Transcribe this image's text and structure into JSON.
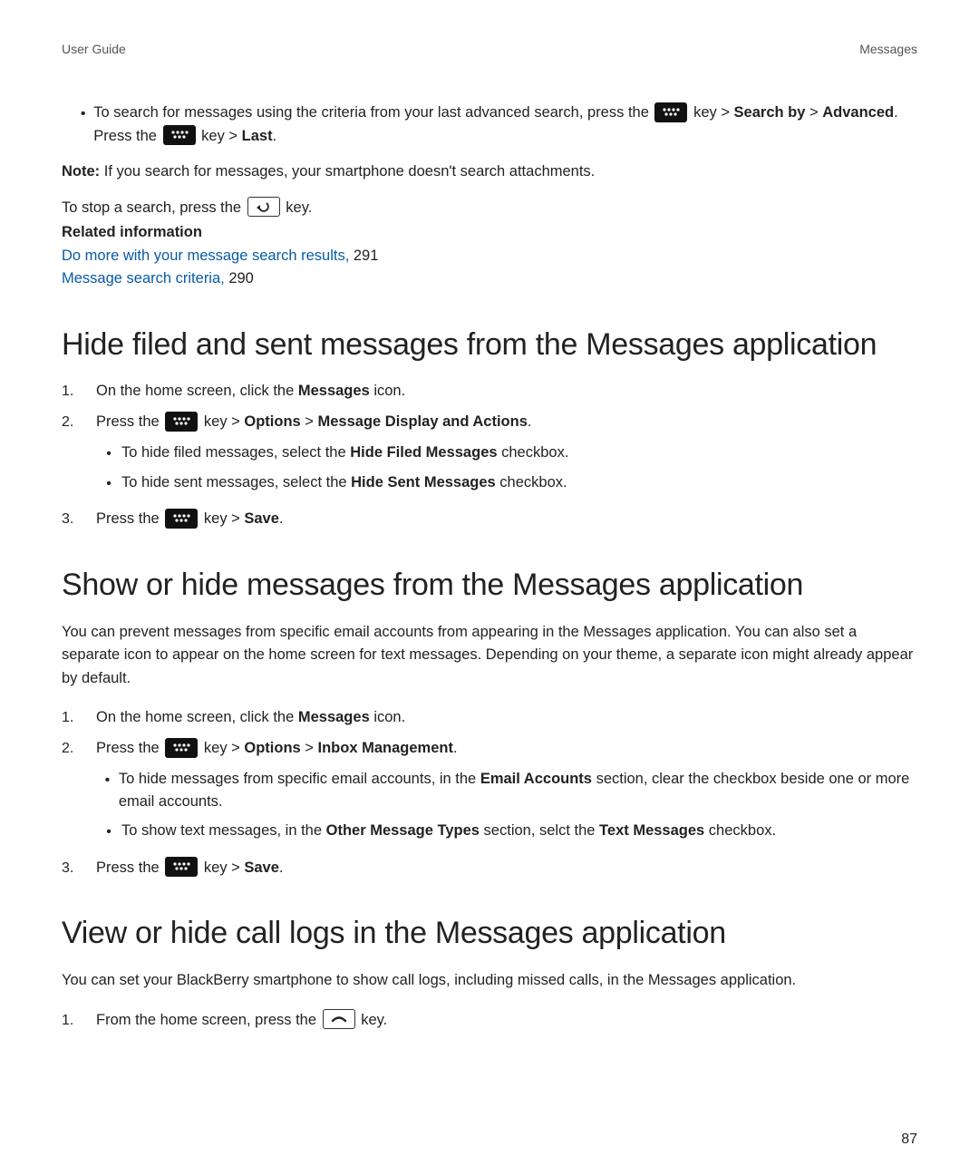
{
  "header": {
    "left": "User Guide",
    "right": "Messages"
  },
  "searchBullet": {
    "pre": "To search for messages using the criteria from your last advanced search, press the ",
    "key1": " key > ",
    "searchBy": "Search by",
    "gt1": " > ",
    "advanced": "Advanced",
    "pressThe": ". Press the ",
    "key2": " key > ",
    "last": "Last",
    "period": "."
  },
  "note": {
    "label": "Note:",
    "text": " If you search for messages, your smartphone doesn't search attachments."
  },
  "stopSearch": {
    "pre": "To stop a search, press the ",
    "post": " key."
  },
  "related": {
    "heading": "Related information",
    "link1": "Do more with your message search results,",
    "num1": " 291",
    "link2": "Message search criteria,",
    "num2": " 290"
  },
  "sectionA": {
    "title": "Hide filed and sent messages from the Messages application",
    "step1": {
      "pre": "On the home screen, click the ",
      "bold": "Messages",
      "post": " icon."
    },
    "step2": {
      "pre": "Press the ",
      "key": " key > ",
      "opt": "Options",
      "gt": " > ",
      "mda": "Message Display and Actions",
      "period": ".",
      "sub1": {
        "pre": "To hide filed messages, select the ",
        "bold": "Hide Filed Messages",
        "post": " checkbox."
      },
      "sub2": {
        "pre": "To hide sent messages, select the ",
        "bold": "Hide Sent Messages",
        "post": " checkbox."
      }
    },
    "step3": {
      "pre": "Press the ",
      "key": " key > ",
      "save": "Save",
      "period": "."
    }
  },
  "sectionB": {
    "title": "Show or hide messages from the Messages application",
    "para": "You can prevent messages from specific email accounts from appearing in the Messages application. You can also set a separate icon to appear on the home screen for text messages. Depending on your theme, a separate icon might already appear by default.",
    "step1": {
      "pre": "On the home screen, click the ",
      "bold": "Messages",
      "post": " icon."
    },
    "step2": {
      "pre": "Press the ",
      "key": " key > ",
      "opt": "Options",
      "gt": " > ",
      "im": "Inbox Management",
      "period": ".",
      "sub1": {
        "pre": "To hide messages from specific email accounts, in the ",
        "bold": "Email Accounts",
        "post": " section, clear the checkbox beside one or more email accounts."
      },
      "sub2": {
        "pre": "To show text messages, in the ",
        "bold1": "Other Message Types",
        "mid": " section, selct the ",
        "bold2": "Text Messages",
        "post": " checkbox."
      }
    },
    "step3": {
      "pre": "Press the ",
      "key": " key > ",
      "save": "Save",
      "period": "."
    }
  },
  "sectionC": {
    "title": "View or hide call logs in the Messages application",
    "para": "You can set your BlackBerry smartphone to show call logs, including missed calls, in the Messages application.",
    "step1": {
      "pre": "From the home screen, press the ",
      "post": " key."
    }
  },
  "pageNumber": "87"
}
